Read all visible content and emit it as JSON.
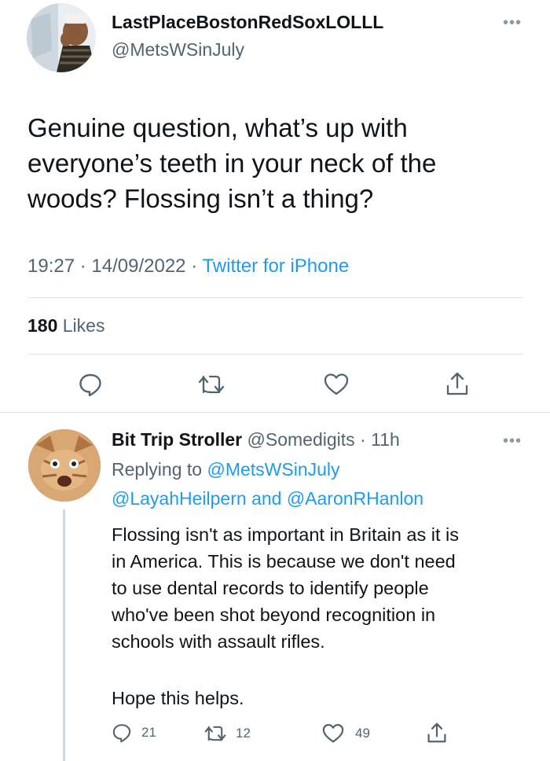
{
  "main_tweet": {
    "display_name": "LastPlaceBostonRedSoxLOLLL",
    "handle": "@MetsWSinJuly",
    "text_lines": [
      "Genuine question, what’s up with",
      "everyone’s teeth in your neck of the",
      "woods? Flossing isn’t a thing?"
    ],
    "time": "19:27",
    "date": "14/09/2022",
    "source": "Twitter for iPhone",
    "likes_count": "180",
    "likes_label": "Likes",
    "actions": [
      "reply-icon",
      "retweet-icon",
      "like-icon",
      "share-icon"
    ]
  },
  "reply_tweet": {
    "display_name": "Bit Trip Stroller",
    "handle": "@Somedigits",
    "age": "11h",
    "replying_prefix": "Replying to",
    "replying_to_1": "@MetsWSinJuly",
    "replying_to_2": "@LayahHeilpern",
    "replying_and": "and",
    "replying_to_3": "@AaronRHanlon",
    "text_lines": [
      "Flossing isn't as important in Britain as it is",
      "in America. This is because we don't need",
      "to use dental records to identify people",
      "who've been shot beyond recognition in",
      "schools with assault rifles."
    ],
    "closing_line": "Hope this helps.",
    "reply_count": "21",
    "retweet_count": "12",
    "like_count": "49"
  },
  "colors": {
    "text": "#0f1419",
    "secondary": "#536471",
    "link": "#1d9bf0",
    "divider": "#e3e6e8"
  }
}
